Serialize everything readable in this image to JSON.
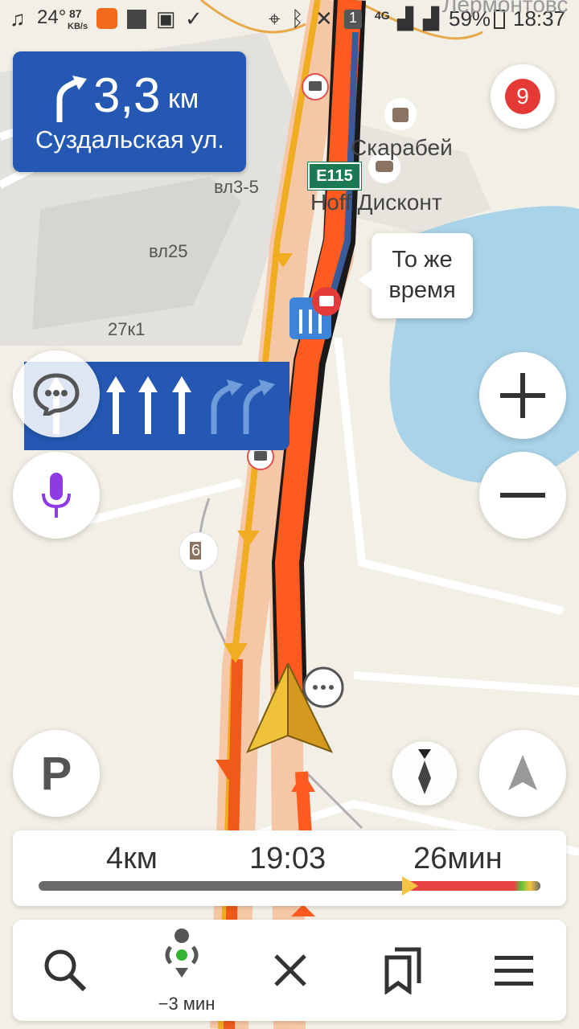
{
  "status_bar": {
    "temperature": "24°",
    "net_speed": "87",
    "net_unit": "KB/s",
    "network": "4G",
    "battery": "59%",
    "time": "18:37",
    "notification_count": "1"
  },
  "maneuver": {
    "distance": "3,3",
    "unit": "км",
    "street": "Суздальская ул.",
    "icon": "turn-right-arrow-icon"
  },
  "map": {
    "labels": {
      "house_1": "вл3-5",
      "house_2": "вл25",
      "house_3": "27к1",
      "poi_1": "Скарабей",
      "poi_2": "Hoff Дисконт",
      "road_sign": "E115",
      "street_top": "Лермонтовс",
      "fuel_number": "6"
    },
    "bubble": {
      "line1": "То же",
      "line2": "время"
    },
    "traffic_badge": "9"
  },
  "lanes": {
    "count_straight": 4,
    "count_right": 2
  },
  "route": {
    "distance": "4км",
    "arrival": "19:03",
    "duration": "26мин",
    "progress": 0.74
  },
  "bottom_bar": {
    "eta_delta": "−3 мин"
  },
  "colors": {
    "maneuver_bg": "#2458b3",
    "route_orange": "#ff5a1f",
    "route_dark": "#2b2b2b",
    "traffic_red": "#e84343",
    "accent_purple": "#8e3be6"
  }
}
